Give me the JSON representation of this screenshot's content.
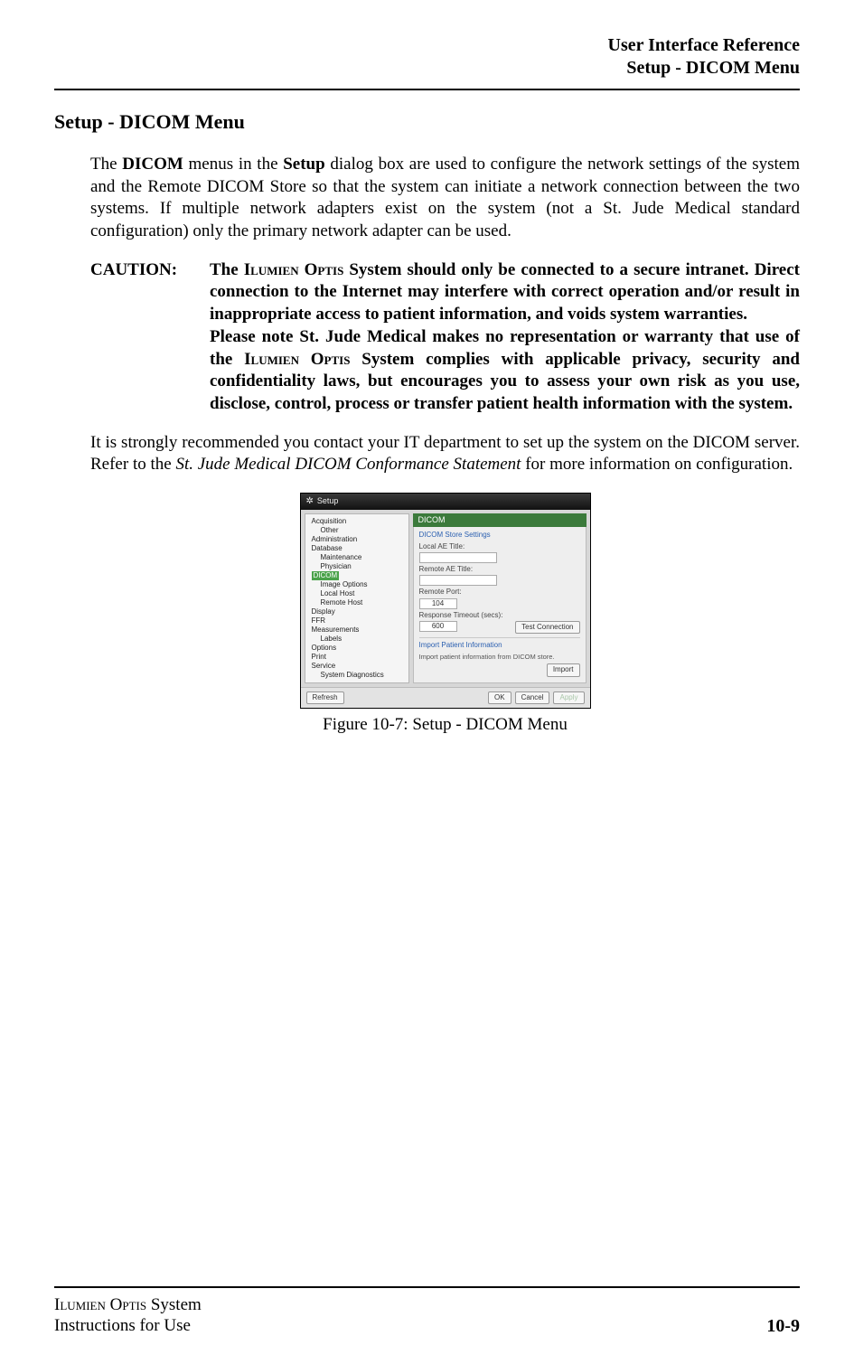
{
  "header": {
    "line1": "User Interface Reference",
    "line2": "Setup - DICOM Menu"
  },
  "section_title": "Setup - DICOM Menu",
  "paragraphs": {
    "intro_prefix": "The ",
    "intro_b1": "DICOM",
    "intro_mid": " menus in the ",
    "intro_b2": "Setup",
    "intro_rest": " dialog box are used to configure the network settings of the system and the Remote DICOM Store so that the system can initiate a network con­nection between the two systems.  If multiple network adapters exist on the system (not a St. Jude Medical standard configuration) only the primary network adapter can be used.",
    "caution_label": "CAUTION:",
    "caution_p1_a": "The ",
    "caution_p1_smallcaps1": "Ilumien Optis",
    "caution_p1_b": " System should only be connected to a secure intranet. Direct connection to the Internet may interfere with correct operation and/or result in inappropriate access to patient information, and voids system warranties.",
    "caution_p2_a": "Please note St. Jude Medical makes no representation or warranty that use of the ",
    "caution_p2_smallcaps": "Ilumien Optis",
    "caution_p2_b": " System complies with applicable pri­vacy, security and confidentiality laws, but encourages you to assess your own risk as you use, disclose, control, process or transfer patient health information with the system.",
    "rec_a": "It is strongly recommended you contact your IT department to set up the system on the DICOM server. Refer to the ",
    "rec_i": "St. Jude Medical DICOM Conformance Statement",
    "rec_b": " for more information on configuration."
  },
  "figure": {
    "caption": "Figure 10-7:  Setup - DICOM Menu"
  },
  "footer": {
    "left_line1_sc": "Ilumien Optis",
    "left_line1_rest": " System",
    "left_line2": "Instructions for Use",
    "right": "10-9"
  },
  "screenshot": {
    "title": "Setup",
    "tree": {
      "acquisition": "Acquisition",
      "other": "Other",
      "administration": "Administration",
      "database": "Database",
      "maintenance": "Maintenance",
      "physician": "Physician",
      "dicom": "DICOM",
      "image_options": "Image Options",
      "local_host": "Local Host",
      "remote_host": "Remote Host",
      "display": "Display",
      "ffr": "FFR",
      "measurements": "Measurements",
      "labels": "Labels",
      "options": "Options",
      "print": "Print",
      "service": "Service",
      "system_diagnostics": "System Diagnostics"
    },
    "panel_header": "DICOM",
    "group1_title": "DICOM Store Settings",
    "local_ae_label": "Local AE Title:",
    "remote_ae_label": "Remote AE Title:",
    "remote_port_label": "Remote Port:",
    "remote_port_value": "104",
    "response_timeout_label": "Response Timeout (secs):",
    "response_timeout_value": "600",
    "test_connection": "Test Connection",
    "group2_title": "Import Patient Information",
    "group2_text": "Import patient information from DICOM store.",
    "import_btn": "Import",
    "refresh_btn": "Refresh",
    "ok_btn": "OK",
    "cancel_btn": "Cancel",
    "apply_btn": "Apply"
  }
}
